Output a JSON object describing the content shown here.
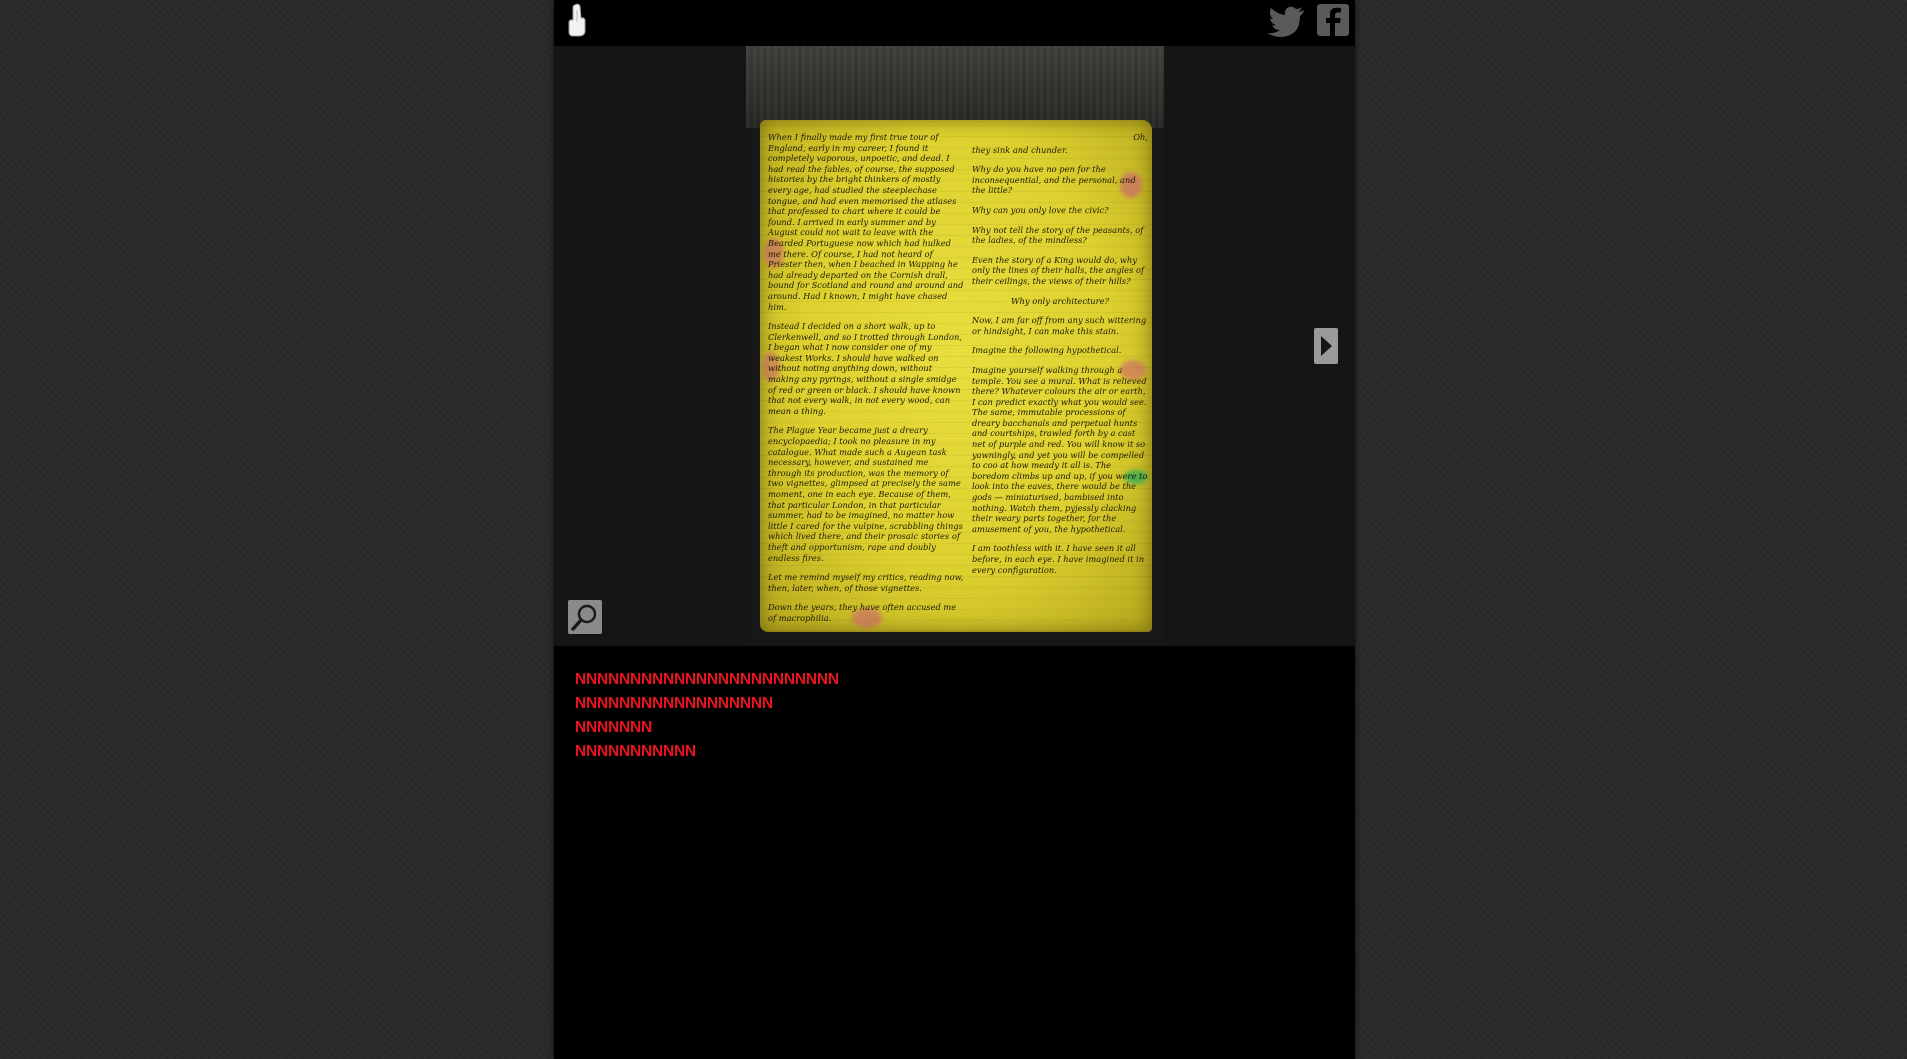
{
  "topbar": {
    "logo_icon": "thumb-logo-icon",
    "twitter_icon": "twitter-icon",
    "facebook_icon": "facebook-icon"
  },
  "viewer": {
    "next_icon": "play-arrow-icon",
    "zoom_icon": "magnifier-icon",
    "page": {
      "left_column": [
        "When I finally made my first true tour of England, early in my career, I found it completely vaporous, unpoetic, and dead. I had read the fables, of course, the supposed histories by the bright thinkers of mostly every age, had studied the steeplechase tongue, and had even memorised the atlases that professed to chart where it could be found. I arrived in early summer and by August could not wait to leave with the Bearded Portuguese now which had hulked me there. Of course, I had not heard of Priester then, when I beached in Wapping he had already departed on the Cornish drall, bound for Scotland and round and around and around. Had I known, I might have chased him.",
        "Instead I decided on a short walk, up to Clerkenwell, and so I trotted through London, I began what I now consider one of my weakest Works. I should have walked on without noting anything down, without making any pyrings, without a single smidge of red or green or black. I should have known that not every walk, in not every wood, can mean a thing.",
        "The Plague Year became just a dreary encyclopaedia; I took no pleasure in my catalogue. What made such a Augean task necessary, however, and sustained me through its production, was the memory of two vignettes, glimpsed at precisely the same moment, one in each eye. Because of them, that particular London, in that particular summer, had to be imagined, no matter how little I cared for the vulpine, scrabbling things which lived there, and their prosaic stories of theft and opportunism, rape and doubly endless fires.",
        "Let me remind myself my critics, reading now, then, later, when, of those vignettes.",
        "Down the years, they have often accused me of macrophilia."
      ],
      "right_column": [
        "Oh,",
        "they sink and chunder.",
        "Why do you have no pen for the inconsequential, and the personal, and the little?",
        "Why can you only love the civic?",
        "Why not tell the story of the peasants, of the ladies, of the mindless?",
        "Even the story of a King would do, why only the lines of their halls, the angles of their ceilings, the views of their hills?",
        "Why only architecture?",
        "Now, I am far off from any such wittering or hindsight, I can make this stain.",
        "Imagine the following hypothetical.",
        "Imagine yourself walking through a temple. You see a mural. What is relieved there? Whatever colours the air or earth, I can predict exactly what you would see. The same, immutable processions of dreary bacchanals and perpetual hunts and courtships, trawled forth by a cast net of purple and red. You will know it so yawningly, and yet you will be compelled to coo at how meady it all is. The boredom climbs up and up, if you were to look into the eaves, there would be the gods — miniaturised, bambised into nothing. Watch them, pyjessly clacking their weary parts together, for the amusement of you, the hypothetical.",
        "I am toothless with it. I have seen it all before, in each eye. I have imagined it in every configuration."
      ]
    }
  },
  "text_panel": {
    "lines": [
      "NNNNNNNNNNNNNNNNNNNNNNNN",
      "NNNNNNNNNNNNNNNNNN",
      "NNNNNNN",
      "NNNNNNNNNNN"
    ],
    "color": "#e8141e"
  }
}
